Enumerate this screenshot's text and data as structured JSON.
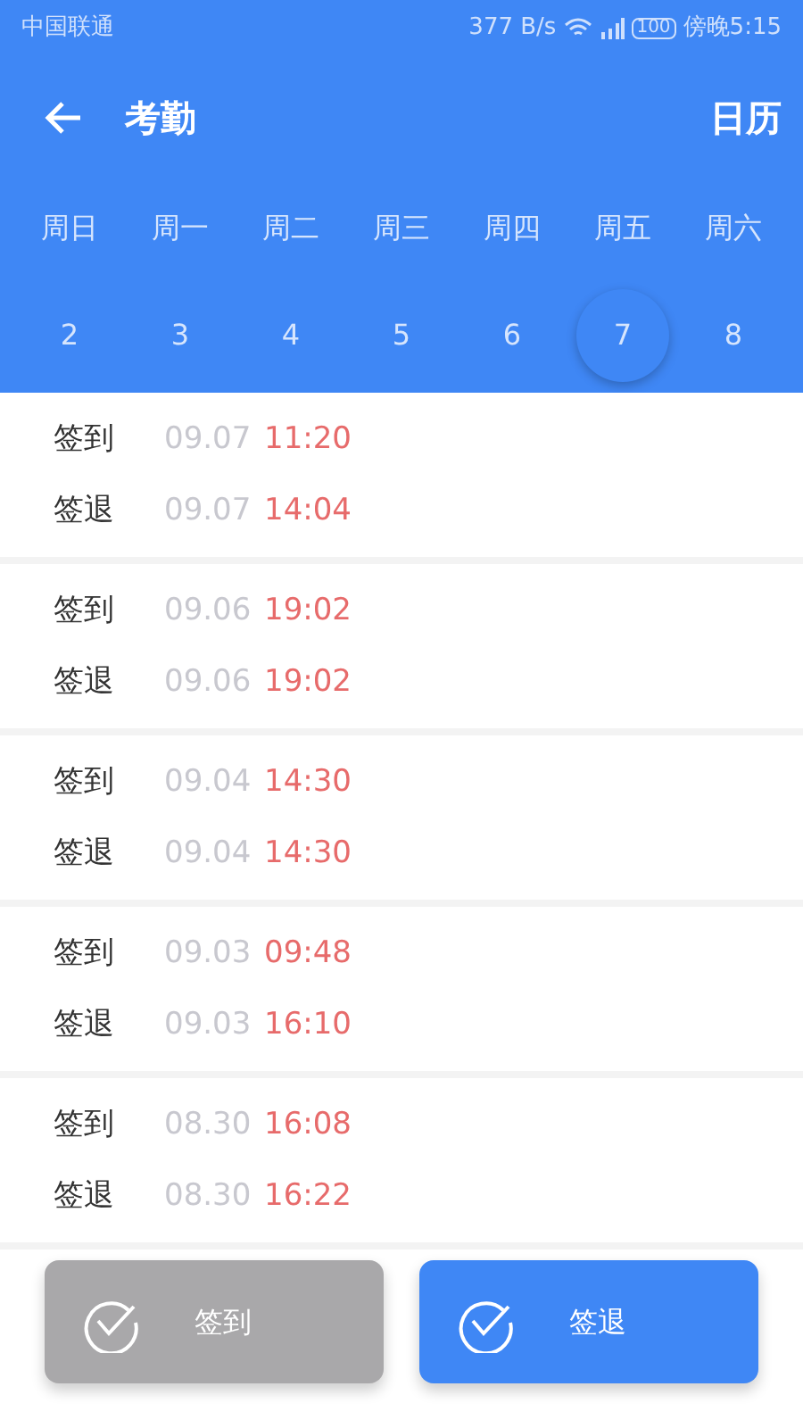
{
  "status_bar": {
    "carrier": "中国联通",
    "speed": "377 B/s",
    "battery": "100",
    "time": "傍晚5:15"
  },
  "header": {
    "title": "考勤",
    "action": "日历"
  },
  "week": [
    {
      "weekday": "周日",
      "date": "2",
      "selected": false
    },
    {
      "weekday": "周一",
      "date": "3",
      "selected": false
    },
    {
      "weekday": "周二",
      "date": "4",
      "selected": false
    },
    {
      "weekday": "周三",
      "date": "5",
      "selected": false
    },
    {
      "weekday": "周四",
      "date": "6",
      "selected": false
    },
    {
      "weekday": "周五",
      "date": "7",
      "selected": true
    },
    {
      "weekday": "周六",
      "date": "8",
      "selected": false
    }
  ],
  "records": [
    {
      "entries": [
        {
          "label": "签到",
          "date": "09.07",
          "time": "11:20"
        },
        {
          "label": "签退",
          "date": "09.07",
          "time": "14:04"
        }
      ]
    },
    {
      "entries": [
        {
          "label": "签到",
          "date": "09.06",
          "time": "19:02"
        },
        {
          "label": "签退",
          "date": "09.06",
          "time": "19:02"
        }
      ]
    },
    {
      "entries": [
        {
          "label": "签到",
          "date": "09.04",
          "time": "14:30"
        },
        {
          "label": "签退",
          "date": "09.04",
          "time": "14:30"
        }
      ]
    },
    {
      "entries": [
        {
          "label": "签到",
          "date": "09.03",
          "time": "09:48"
        },
        {
          "label": "签退",
          "date": "09.03",
          "time": "16:10"
        }
      ]
    },
    {
      "entries": [
        {
          "label": "签到",
          "date": "08.30",
          "time": "16:08"
        },
        {
          "label": "签退",
          "date": "08.30",
          "time": "16:22"
        }
      ]
    }
  ],
  "actions": [
    {
      "label": "签到",
      "disabled": true
    },
    {
      "label": "签退",
      "disabled": false
    }
  ]
}
